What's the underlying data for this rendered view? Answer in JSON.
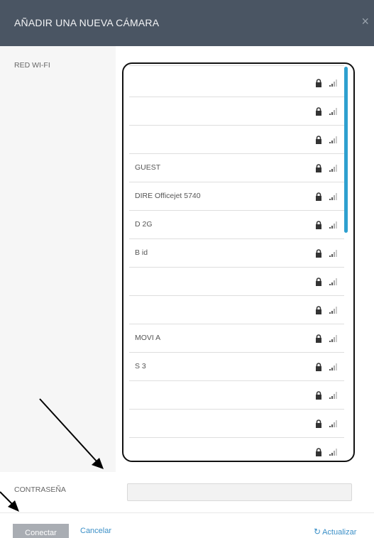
{
  "dialog": {
    "title": "AÑADIR UNA NUEVA CÁMARA",
    "close": "×"
  },
  "labels": {
    "wifi": "RED WI-FI",
    "password": "CONTRASEÑA"
  },
  "networks": [
    {
      "ssid": "",
      "locked": true
    },
    {
      "ssid": "",
      "locked": true
    },
    {
      "ssid": "",
      "locked": true
    },
    {
      "ssid": "GUEST",
      "locked": true
    },
    {
      "ssid": "DIRE Officejet 5740",
      "locked": true
    },
    {
      "ssid": "D 2G",
      "locked": true
    },
    {
      "ssid": "B id",
      "locked": true
    },
    {
      "ssid": "",
      "locked": true
    },
    {
      "ssid": "",
      "locked": true
    },
    {
      "ssid": "MOVI A",
      "locked": true
    },
    {
      "ssid": "S 3",
      "locked": true
    },
    {
      "ssid": "",
      "locked": true
    },
    {
      "ssid": "",
      "locked": true
    },
    {
      "ssid": "",
      "locked": true
    }
  ],
  "password": {
    "value": ""
  },
  "footer": {
    "connect": "Conectar",
    "cancel": "Cancelar",
    "refresh": "Actualizar",
    "refresh_icon": "↻"
  },
  "colors": {
    "header": "#4a5563",
    "accent": "#2ea0cf",
    "link": "#3a8fc7"
  }
}
